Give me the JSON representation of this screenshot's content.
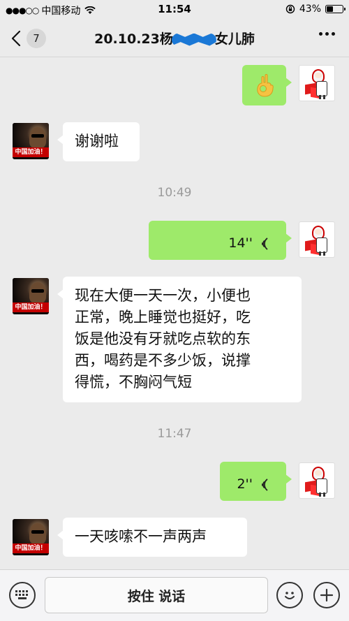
{
  "status_bar": {
    "signal_dots": "●●●○○",
    "carrier": "中国移动",
    "time": "11:54",
    "battery_percent": "43%",
    "battery_level": 0.43
  },
  "nav": {
    "back_count": "7",
    "title_prefix": "20.10.23杨",
    "title_suffix": "女儿肺"
  },
  "other_avatar_caption": "中国加油！",
  "messages": [
    {
      "from": "me",
      "type": "emoji",
      "icon": "ok-hand-emoji"
    },
    {
      "from": "other",
      "type": "text",
      "text": "谢谢啦"
    },
    {
      "type": "time",
      "text": "10:49"
    },
    {
      "from": "me",
      "type": "voice",
      "duration": "14''"
    },
    {
      "from": "other",
      "type": "text",
      "lines": [
        "现在大便一天一次，小便也",
        "正常，晚上睡觉也挺好，吃",
        "饭是他没有牙就吃点软的东",
        "西，喝药是不多少饭，说撑",
        "得慌，不胸闷气短"
      ]
    },
    {
      "type": "time",
      "text": "11:47"
    },
    {
      "from": "me",
      "type": "voice",
      "duration": "2''"
    },
    {
      "from": "other",
      "type": "text",
      "text": "一天咳嗦不一声两声"
    }
  ],
  "input_bar": {
    "hold_to_talk": "按住 说话"
  },
  "colors": {
    "background": "#ebebeb",
    "my_bubble": "#9eea6a",
    "other_bubble": "#ffffff"
  }
}
